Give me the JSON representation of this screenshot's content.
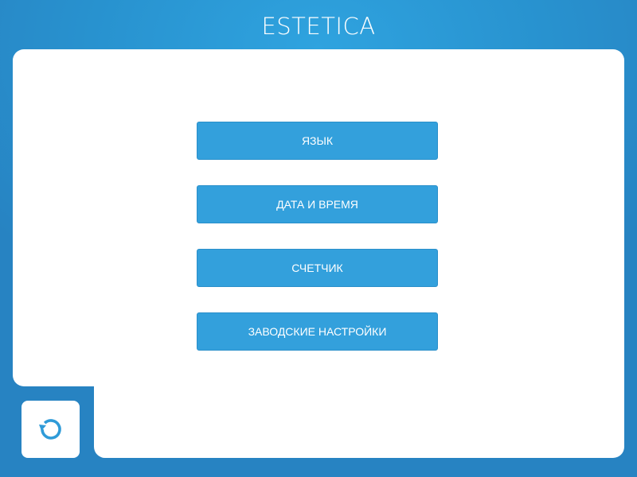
{
  "header": {
    "title": "ESTETICA"
  },
  "menu": {
    "items": [
      {
        "label": "ЯЗЫК",
        "name": "language-button"
      },
      {
        "label": "ДАТА И ВРЕМЯ",
        "name": "date-time-button"
      },
      {
        "label": "СЧЕТЧИК",
        "name": "counter-button"
      },
      {
        "label": "ЗАВОДСКИЕ НАСТРОЙКИ",
        "name": "factory-settings-button"
      }
    ]
  },
  "footer": {
    "back_icon": "undo-icon"
  },
  "colors": {
    "background": "#2892cf",
    "button": "#33a0dc",
    "panel": "#ffffff",
    "icon": "#2f9bd8"
  }
}
